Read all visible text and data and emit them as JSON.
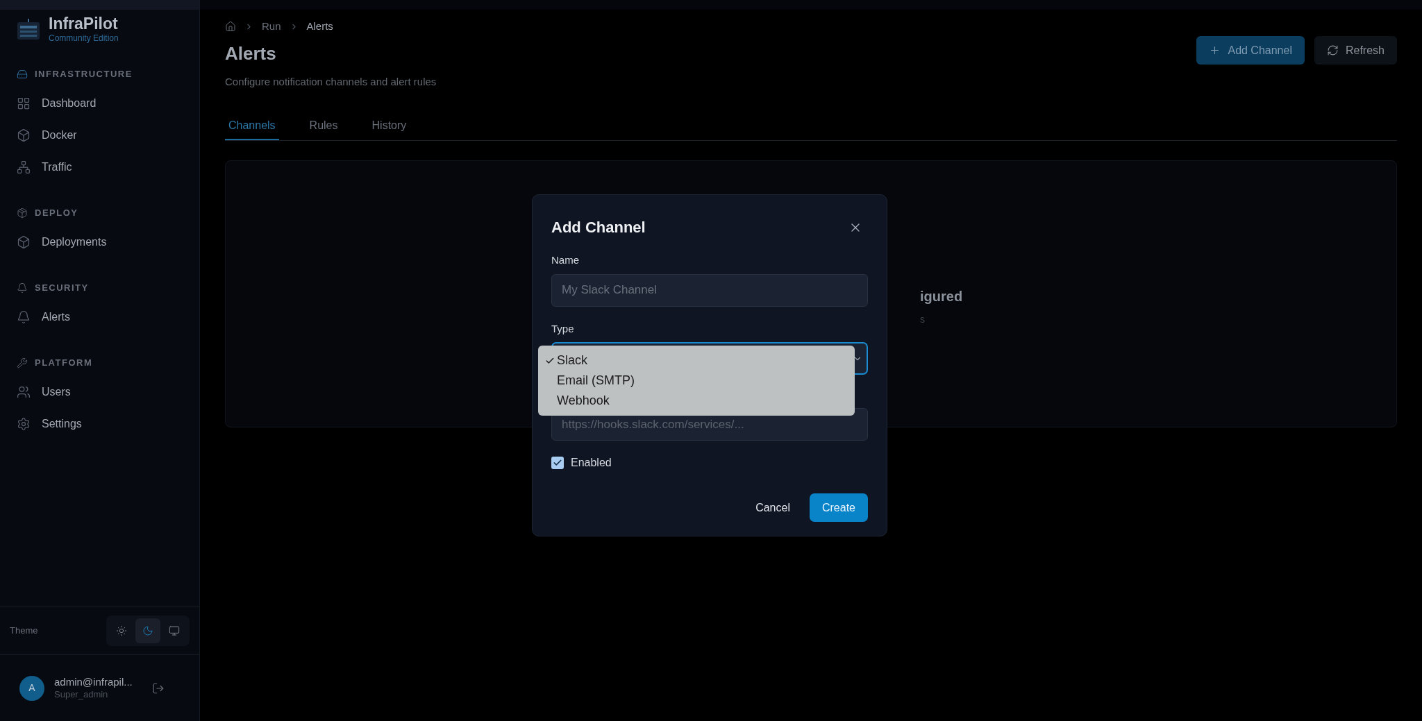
{
  "sidebar": {
    "brand": {
      "name": "InfraPilot",
      "edition": "Community Edition"
    },
    "sections": [
      {
        "title": "INFRASTRUCTURE",
        "items": [
          {
            "label": "Dashboard"
          },
          {
            "label": "Docker"
          },
          {
            "label": "Traffic"
          }
        ]
      },
      {
        "title": "DEPLOY",
        "items": [
          {
            "label": "Deployments"
          }
        ]
      },
      {
        "title": "SECURITY",
        "items": [
          {
            "label": "Alerts"
          }
        ]
      },
      {
        "title": "PLATFORM",
        "items": [
          {
            "label": "Users"
          },
          {
            "label": "Settings"
          }
        ]
      }
    ],
    "theme": {
      "label": "Theme",
      "options": [
        {
          "kind": "light",
          "selected": false
        },
        {
          "kind": "dark",
          "selected": true
        },
        {
          "kind": "system",
          "selected": false
        }
      ]
    },
    "user": {
      "initial": "A",
      "email": "admin@infrapil...",
      "role": "Super_admin"
    }
  },
  "breadcrumb": [
    "Run",
    "Alerts"
  ],
  "page": {
    "title": "Alerts",
    "subtitle": "Configure notification channels and alert rules",
    "actions": [
      {
        "kind": "primary",
        "label": "Add Channel"
      },
      {
        "kind": "secondary",
        "label": "Refresh"
      }
    ]
  },
  "tabs": [
    {
      "label": "Channels",
      "selected": true
    },
    {
      "label": "Rules",
      "selected": false
    },
    {
      "label": "History",
      "selected": false
    }
  ],
  "empty_state": {
    "title": "igured",
    "text": "s"
  },
  "dialog": {
    "title": "Add Channel",
    "name_field": {
      "label": "Name",
      "placeholder": "My Slack Channel"
    },
    "type_field": {
      "label": "Type",
      "options": [
        {
          "label": "Slack",
          "selected": true
        },
        {
          "label": "Email (SMTP)",
          "selected": false
        },
        {
          "label": "Webhook",
          "selected": false
        }
      ]
    },
    "url_field": {
      "placeholder": "https://hooks.slack.com/services/..."
    },
    "enabled": {
      "label": "Enabled",
      "checked": true
    },
    "buttons": [
      {
        "kind": "secondary",
        "label": "Cancel"
      },
      {
        "kind": "primary",
        "label": "Create"
      }
    ]
  }
}
